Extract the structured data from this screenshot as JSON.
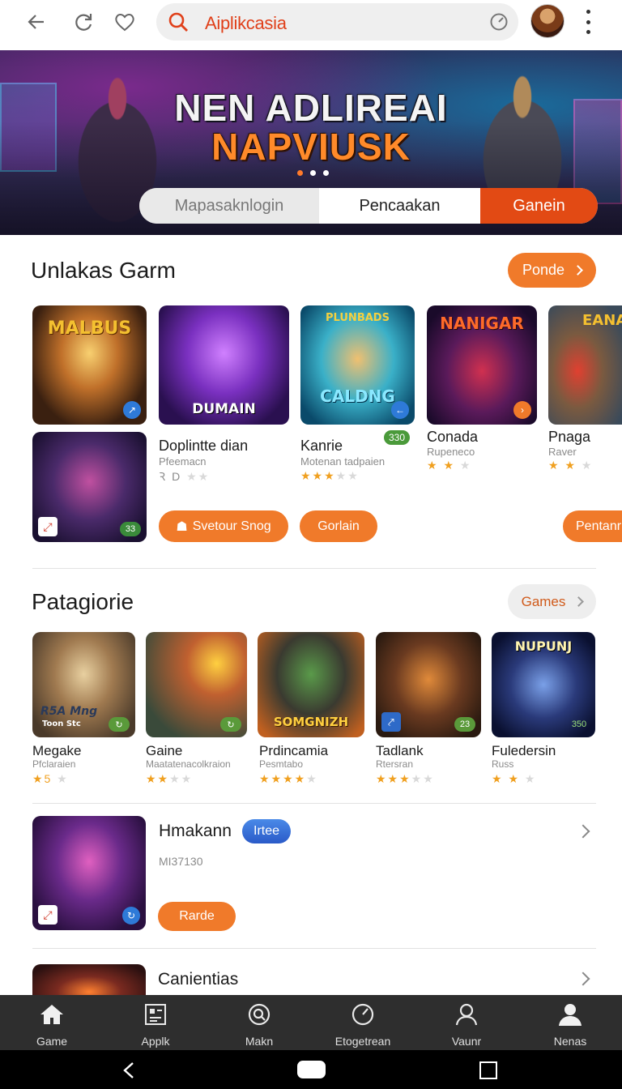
{
  "topbar": {
    "search_text": "Aiplikcasia",
    "icons": [
      "back-arrow-icon",
      "refresh-icon",
      "heart-icon",
      "search-icon",
      "timer-icon",
      "more-vertical-icon"
    ]
  },
  "banner": {
    "headline_line1": "NEN ADLIREAI",
    "headline_line2": "NAPVIUSK",
    "segments": [
      "Mapasaknlogin",
      "Pencaakan",
      "Ganein"
    ],
    "active_segment": 2
  },
  "section1": {
    "title": "Unlakas Garm",
    "action_label": "Ponde",
    "tiles": [
      {
        "caption": "MALBUS",
        "badge": "↗"
      },
      {
        "caption": "DUMAIN"
      },
      {
        "caption": "PLUNBADS",
        "caption2": "CALDNG",
        "badge": "←"
      },
      {
        "caption": "NANIGAR",
        "badge": "›"
      },
      {
        "caption": "EANA"
      },
      {
        "badge": "33"
      }
    ],
    "items": [
      {
        "title": "Doplintte dian",
        "subtitle": "Pfeemacn",
        "rating_text": "Ꝛ D",
        "stars_filled": 0,
        "stars_empty": 2
      },
      {
        "title": "Kanrie",
        "badge": "330",
        "subtitle": "Motenan tadpaien",
        "stars_filled": 3,
        "stars_empty": 2
      },
      {
        "title": "Conada",
        "subtitle": "Rupeneco",
        "stars_filled": 2,
        "stars_empty": 1
      },
      {
        "title": "Pnaga",
        "subtitle": "Raver",
        "stars_filled": 2,
        "stars_empty": 1
      }
    ],
    "buttons": [
      "Svetour Snog",
      "Gorlain",
      "Pentanr"
    ]
  },
  "section2": {
    "title": "Patagiorie",
    "action_label": "Games",
    "tiles": [
      {
        "caption": "R5A Mng",
        "caption2": "Toon Stc",
        "badge": "↻"
      },
      {
        "badge": "↻"
      },
      {
        "caption": "SOMGNIZH"
      },
      {
        "badge": "23"
      },
      {
        "caption": "NUPUNJ",
        "badge": "350"
      }
    ],
    "items": [
      {
        "title": "Megake",
        "subtitle": "Pfclaraien",
        "rating_text": "★5",
        "stars_filled": 1,
        "stars_empty": 1
      },
      {
        "title": "Gaine",
        "subtitle": "Maatatenacolkraion",
        "stars_filled": 2,
        "stars_empty": 2
      },
      {
        "title": "Prdincamia",
        "subtitle": "Pesmtabo",
        "stars_filled": 4,
        "stars_empty": 1
      },
      {
        "title": "Tadlank",
        "subtitle": "Rtersran",
        "stars_filled": 3,
        "stars_empty": 2
      },
      {
        "title": "Fuledersin",
        "subtitle": "Russ",
        "stars_filled": 2,
        "stars_empty": 1
      }
    ]
  },
  "list_rows": [
    {
      "title": "Hmakann",
      "tag": "Irtee",
      "meta": "MI37130",
      "button": "Rarde"
    },
    {
      "title": "Canientias"
    }
  ],
  "bottom_nav": [
    {
      "label": "Game",
      "icon": "home-icon"
    },
    {
      "label": "Applk",
      "icon": "apps-icon"
    },
    {
      "label": "Makn",
      "icon": "search-circle-icon"
    },
    {
      "label": "Etogetrean",
      "icon": "gauge-icon"
    },
    {
      "label": "Vaunr",
      "icon": "user-icon"
    },
    {
      "label": "Nenas",
      "icon": "profile-icon"
    }
  ],
  "colors": {
    "accent": "#f07a2a",
    "accent_dark": "#e24a14",
    "nav_bg": "#2e2e2e",
    "search_text": "#e0401a",
    "tag_blue": "#2a5ac8"
  }
}
